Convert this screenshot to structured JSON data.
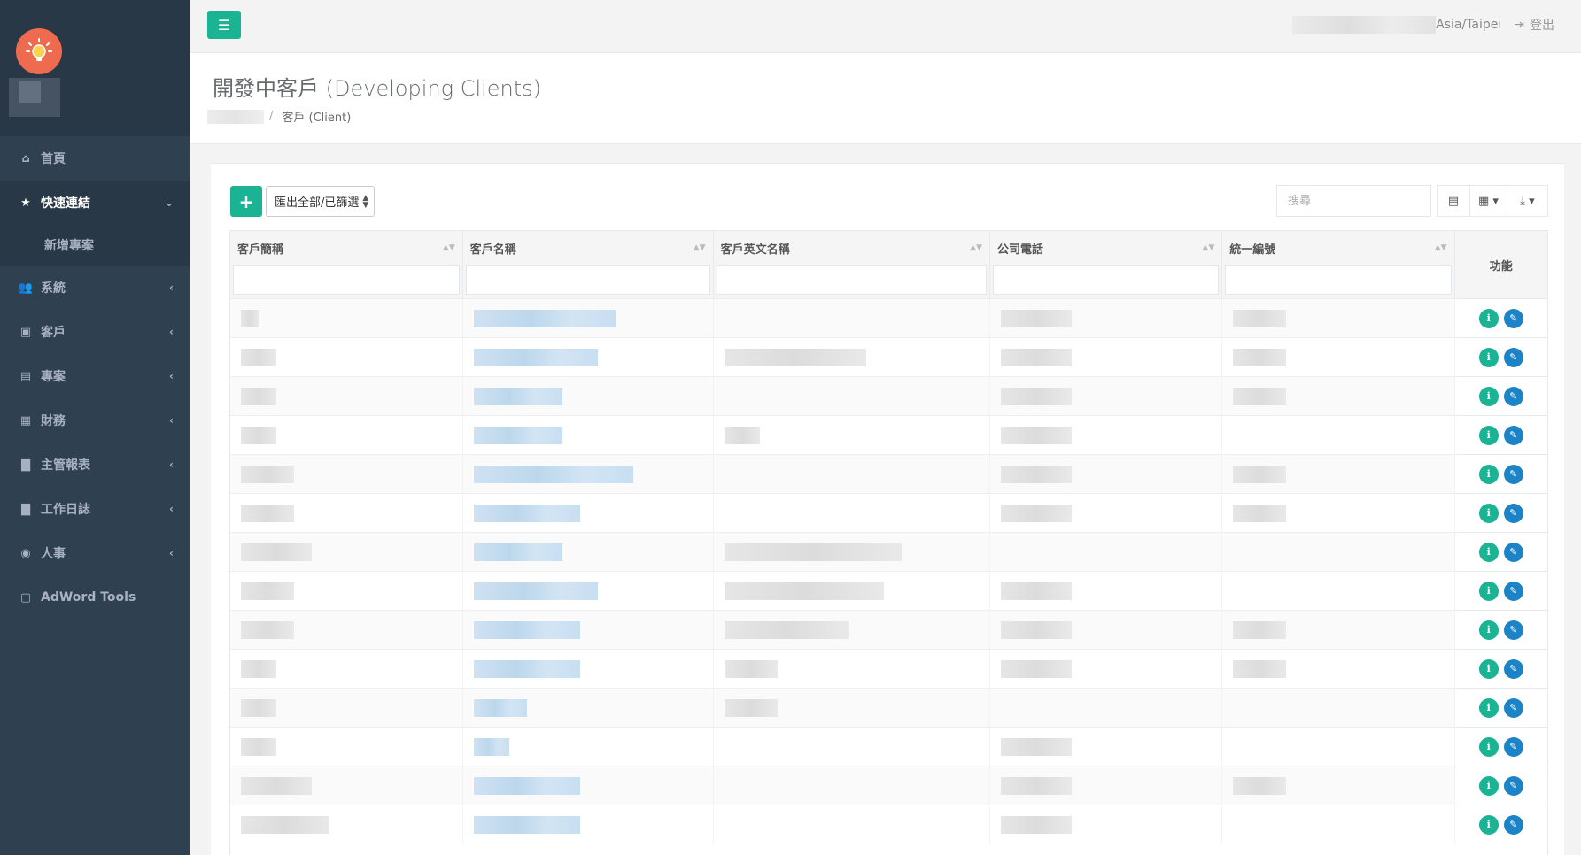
{
  "topbar": {
    "timezone": "Asia/Taipei",
    "logout_label": "登出"
  },
  "sidebar": {
    "items": [
      {
        "label": "首頁",
        "icon": "home-icon",
        "caret": false,
        "active": false
      },
      {
        "label": "快速連結",
        "icon": "star-icon",
        "caret": true,
        "active": true
      },
      {
        "label": "系統",
        "icon": "users-icon",
        "caret": true,
        "active": false
      },
      {
        "label": "客戶",
        "icon": "address-book-icon",
        "caret": true,
        "active": false
      },
      {
        "label": "專案",
        "icon": "briefcase-icon",
        "caret": true,
        "active": false
      },
      {
        "label": "財務",
        "icon": "calculator-icon",
        "caret": true,
        "active": false
      },
      {
        "label": "主管報表",
        "icon": "file-icon",
        "caret": true,
        "active": false
      },
      {
        "label": "工作日誌",
        "icon": "file-icon",
        "caret": true,
        "active": false
      },
      {
        "label": "人事",
        "icon": "user-circle-icon",
        "caret": true,
        "active": false
      },
      {
        "label": "AdWord Tools",
        "icon": "file-excel-icon",
        "caret": false,
        "active": false
      }
    ],
    "subitem": "新增專案"
  },
  "page": {
    "title": "開發中客戶 (Developing Clients)",
    "breadcrumb_current": "客戶 (Client)"
  },
  "toolbar": {
    "add_label": "+",
    "export_label": "匯出全部/已篩選",
    "search_placeholder": "搜尋"
  },
  "table": {
    "columns": [
      "客戶簡稱",
      "客戶名稱",
      "客戶英文名稱",
      "公司電話",
      "統一編號",
      "功能"
    ],
    "row_count": 14
  },
  "colors": {
    "accent": "#1ab394",
    "sidebar": "#2f4050",
    "edit": "#1c84c6"
  }
}
